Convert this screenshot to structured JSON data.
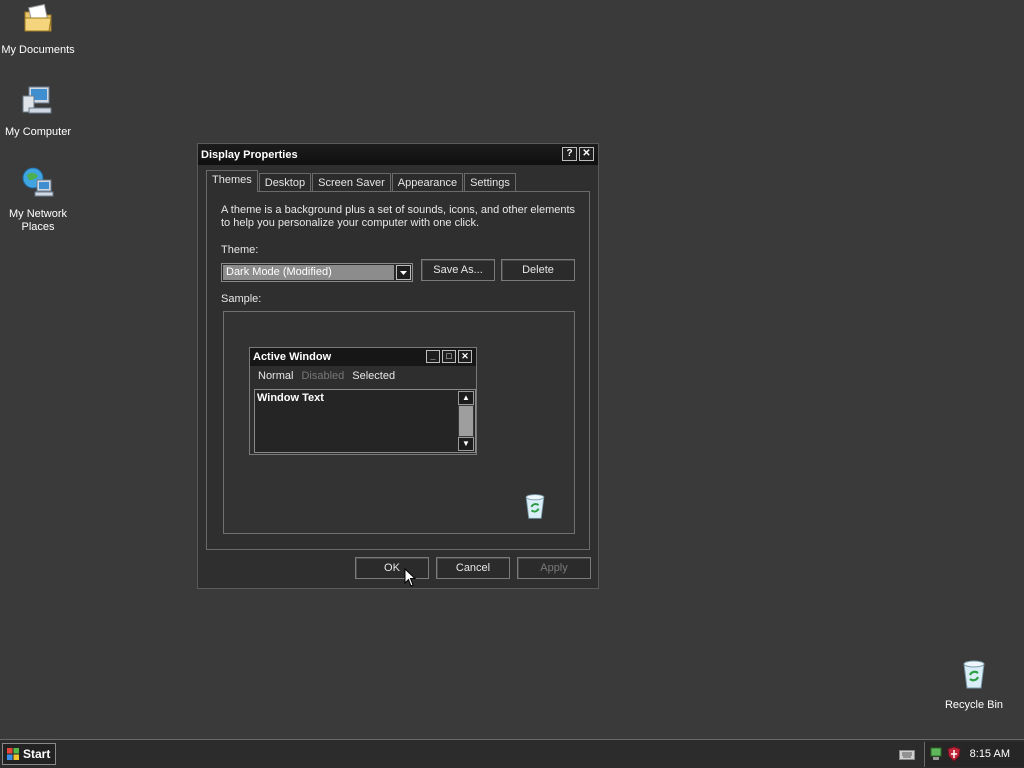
{
  "desktop": {
    "icons": [
      {
        "label": "My Documents",
        "icon": "my-documents-icon"
      },
      {
        "label": "My Computer",
        "icon": "my-computer-icon"
      },
      {
        "label": "My Network Places",
        "icon": "network-places-icon"
      },
      {
        "label": "Recycle Bin",
        "icon": "recycle-bin-icon"
      }
    ]
  },
  "dialog": {
    "title": "Display Properties",
    "help_glyph": "?",
    "close_glyph": "✕",
    "tabs": [
      "Themes",
      "Desktop",
      "Screen Saver",
      "Appearance",
      "Settings"
    ],
    "active_tab": "Themes",
    "description": "A theme is a background plus a set of sounds, icons, and other elements to help you personalize your computer with one click.",
    "theme_label": "Theme:",
    "theme_value": "Dark Mode (Modified)",
    "save_as_label": "Save As...",
    "delete_label": "Delete",
    "sample_label": "Sample:",
    "sample": {
      "window_title": "Active Window",
      "menu_normal": "Normal",
      "menu_disabled": "Disabled",
      "menu_selected": "Selected",
      "window_text": "Window Text"
    },
    "ok_label": "OK",
    "cancel_label": "Cancel",
    "apply_label": "Apply"
  },
  "taskbar": {
    "start_label": "Start",
    "clock": "8:15 AM"
  },
  "colors": {
    "desktop_bg": "#3a3a3a",
    "dialog_bg": "#2f2f2f",
    "selection": "#8c8c8c"
  }
}
